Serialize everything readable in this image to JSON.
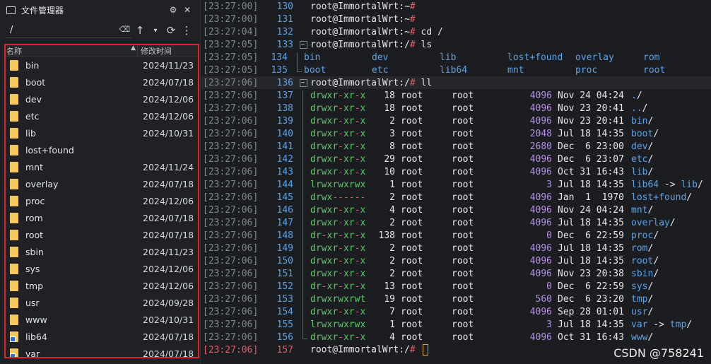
{
  "file_manager": {
    "title": "文件管理器",
    "title_icons": [
      "gear-icon",
      "close-icon"
    ],
    "path": "/",
    "columns": {
      "name": "名称",
      "time": "修改时间"
    },
    "rows": [
      {
        "name": "bin",
        "time": "2024/11/23",
        "type": "folder"
      },
      {
        "name": "boot",
        "time": "2024/07/18",
        "type": "folder"
      },
      {
        "name": "dev",
        "time": "2024/12/06",
        "type": "folder"
      },
      {
        "name": "etc",
        "time": "2024/12/06",
        "type": "folder"
      },
      {
        "name": "lib",
        "time": "2024/10/31",
        "type": "folder"
      },
      {
        "name": "lost+found",
        "time": "",
        "type": "folder"
      },
      {
        "name": "mnt",
        "time": "2024/11/24",
        "type": "folder"
      },
      {
        "name": "overlay",
        "time": "2024/07/18",
        "type": "folder"
      },
      {
        "name": "proc",
        "time": "2024/12/06",
        "type": "folder"
      },
      {
        "name": "rom",
        "time": "2024/07/18",
        "type": "folder"
      },
      {
        "name": "root",
        "time": "2024/07/18",
        "type": "folder"
      },
      {
        "name": "sbin",
        "time": "2024/11/23",
        "type": "folder"
      },
      {
        "name": "sys",
        "time": "2024/12/06",
        "type": "folder"
      },
      {
        "name": "tmp",
        "time": "2024/12/06",
        "type": "folder"
      },
      {
        "name": "usr",
        "time": "2024/09/28",
        "type": "folder"
      },
      {
        "name": "www",
        "time": "2024/10/31",
        "type": "folder"
      },
      {
        "name": "lib64",
        "time": "2024/07/18",
        "type": "link"
      },
      {
        "name": "var",
        "time": "2024/07/18",
        "type": "link"
      }
    ]
  },
  "terminal": {
    "prompt": "root@ImmortalWrt:",
    "lines": [
      {
        "ts": "[23:27:00]",
        "ln": "130",
        "kind": "prompt",
        "cwd": "~",
        "cmd": ""
      },
      {
        "ts": "[23:27:00]",
        "ln": "131",
        "kind": "prompt",
        "cwd": "~",
        "cmd": ""
      },
      {
        "ts": "[23:27:04]",
        "ln": "132",
        "kind": "prompt",
        "cwd": "~",
        "cmd": "cd /"
      },
      {
        "ts": "[23:27:05]",
        "ln": "133",
        "kind": "prompt",
        "cwd": "/",
        "cmd": "ls",
        "fold": "box"
      },
      {
        "ts": "[23:27:05]",
        "ln": "134",
        "kind": "ls",
        "items": [
          "bin",
          "dev",
          "lib",
          "lost+found",
          "overlay",
          "rom"
        ],
        "fold": "bar"
      },
      {
        "ts": "[23:27:05]",
        "ln": "135",
        "kind": "ls",
        "items": [
          "boot",
          "etc",
          "lib64",
          "mnt",
          "proc",
          "root"
        ],
        "fold": "end"
      },
      {
        "ts": "[23:27:06]",
        "ln": "136",
        "kind": "prompt",
        "cwd": "/",
        "cmd": "ll",
        "fold": "box",
        "highlight": true
      },
      {
        "ts": "[23:27:06]",
        "ln": "137",
        "kind": "ll",
        "perm": "drwxr-xr-x",
        "n": "18",
        "owner": "root",
        "group": "root",
        "size": "4096",
        "date": "Nov 24 04:24",
        "name": "./",
        "fold": "bar"
      },
      {
        "ts": "[23:27:06]",
        "ln": "138",
        "kind": "ll",
        "perm": "drwxr-xr-x",
        "n": "18",
        "owner": "root",
        "group": "root",
        "size": "4096",
        "date": "Nov 23 20:41",
        "name": "../",
        "fold": "bar"
      },
      {
        "ts": "[23:27:06]",
        "ln": "139",
        "kind": "ll",
        "perm": "drwxr-xr-x",
        "n": "2",
        "owner": "root",
        "group": "root",
        "size": "4096",
        "date": "Nov 23 20:41",
        "name": "bin/",
        "fold": "bar"
      },
      {
        "ts": "[23:27:06]",
        "ln": "140",
        "kind": "ll",
        "perm": "drwxr-xr-x",
        "n": "3",
        "owner": "root",
        "group": "root",
        "size": "2048",
        "date": "Jul 18 14:35",
        "name": "boot/",
        "fold": "bar"
      },
      {
        "ts": "[23:27:06]",
        "ln": "141",
        "kind": "ll",
        "perm": "drwxr-xr-x",
        "n": "8",
        "owner": "root",
        "group": "root",
        "size": "2680",
        "date": "Dec  6 23:00",
        "name": "dev/",
        "fold": "bar"
      },
      {
        "ts": "[23:27:06]",
        "ln": "142",
        "kind": "ll",
        "perm": "drwxr-xr-x",
        "n": "29",
        "owner": "root",
        "group": "root",
        "size": "4096",
        "date": "Dec  6 23:07",
        "name": "etc/",
        "fold": "bar"
      },
      {
        "ts": "[23:27:06]",
        "ln": "143",
        "kind": "ll",
        "perm": "drwxr-xr-x",
        "n": "10",
        "owner": "root",
        "group": "root",
        "size": "4096",
        "date": "Oct 31 16:43",
        "name": "lib/",
        "fold": "bar"
      },
      {
        "ts": "[23:27:06]",
        "ln": "144",
        "kind": "ll",
        "perm": "lrwxrwxrwx",
        "n": "1",
        "owner": "root",
        "group": "root",
        "size": "3",
        "date": "Jul 18 14:35",
        "name": "lib64 -> lib/",
        "fold": "bar"
      },
      {
        "ts": "[23:27:06]",
        "ln": "145",
        "kind": "ll",
        "perm": "drwx------",
        "n": "2",
        "owner": "root",
        "group": "root",
        "size": "4096",
        "date": "Jan  1  1970",
        "name": "lost+found/",
        "fold": "bar"
      },
      {
        "ts": "[23:27:06]",
        "ln": "146",
        "kind": "ll",
        "perm": "drwxr-xr-x",
        "n": "4",
        "owner": "root",
        "group": "root",
        "size": "4096",
        "date": "Nov 24 04:24",
        "name": "mnt/",
        "fold": "bar"
      },
      {
        "ts": "[23:27:06]",
        "ln": "147",
        "kind": "ll",
        "perm": "drwxr-xr-x",
        "n": "2",
        "owner": "root",
        "group": "root",
        "size": "4096",
        "date": "Jul 18 14:35",
        "name": "overlay/",
        "fold": "bar"
      },
      {
        "ts": "[23:27:06]",
        "ln": "148",
        "kind": "ll",
        "perm": "dr-xr-xr-x",
        "n": "138",
        "owner": "root",
        "group": "root",
        "size": "0",
        "date": "Dec  6 22:59",
        "name": "proc/",
        "fold": "bar"
      },
      {
        "ts": "[23:27:06]",
        "ln": "149",
        "kind": "ll",
        "perm": "drwxr-xr-x",
        "n": "2",
        "owner": "root",
        "group": "root",
        "size": "4096",
        "date": "Jul 18 14:35",
        "name": "rom/",
        "fold": "bar"
      },
      {
        "ts": "[23:27:06]",
        "ln": "150",
        "kind": "ll",
        "perm": "drwxr-xr-x",
        "n": "2",
        "owner": "root",
        "group": "root",
        "size": "4096",
        "date": "Jul 18 14:35",
        "name": "root/",
        "fold": "bar"
      },
      {
        "ts": "[23:27:06]",
        "ln": "151",
        "kind": "ll",
        "perm": "drwxr-xr-x",
        "n": "2",
        "owner": "root",
        "group": "root",
        "size": "4096",
        "date": "Nov 23 20:38",
        "name": "sbin/",
        "fold": "bar"
      },
      {
        "ts": "[23:27:06]",
        "ln": "152",
        "kind": "ll",
        "perm": "dr-xr-xr-x",
        "n": "13",
        "owner": "root",
        "group": "root",
        "size": "0",
        "date": "Dec  6 22:59",
        "name": "sys/",
        "fold": "bar"
      },
      {
        "ts": "[23:27:06]",
        "ln": "153",
        "kind": "ll",
        "perm": "drwxrwxrwt",
        "n": "19",
        "owner": "root",
        "group": "root",
        "size": "560",
        "date": "Dec  6 23:20",
        "name": "tmp/",
        "fold": "bar"
      },
      {
        "ts": "[23:27:06]",
        "ln": "154",
        "kind": "ll",
        "perm": "drwxr-xr-x",
        "n": "7",
        "owner": "root",
        "group": "root",
        "size": "4096",
        "date": "Sep 28 01:01",
        "name": "usr/",
        "fold": "bar"
      },
      {
        "ts": "[23:27:06]",
        "ln": "155",
        "kind": "ll",
        "perm": "lrwxrwxrwx",
        "n": "1",
        "owner": "root",
        "group": "root",
        "size": "3",
        "date": "Jul 18 14:35",
        "name": "var -> tmp/",
        "fold": "bar"
      },
      {
        "ts": "[23:27:06]",
        "ln": "156",
        "kind": "ll",
        "perm": "drwxr-xr-x",
        "n": "4",
        "owner": "root",
        "group": "root",
        "size": "4096",
        "date": "Oct 31 16:43",
        "name": "www/",
        "fold": "end"
      },
      {
        "ts": "[23:27:06]",
        "ln": "157",
        "kind": "prompt",
        "cwd": "/",
        "cmd": "",
        "current": true
      }
    ]
  },
  "watermark": "CSDN @758241",
  "colors": {
    "accent_red": "#e0242a",
    "folder": "#f4c95c",
    "dir_blue": "#5aa3e8",
    "perm_green": "#5fc56b",
    "size_purple": "#b58df0"
  }
}
